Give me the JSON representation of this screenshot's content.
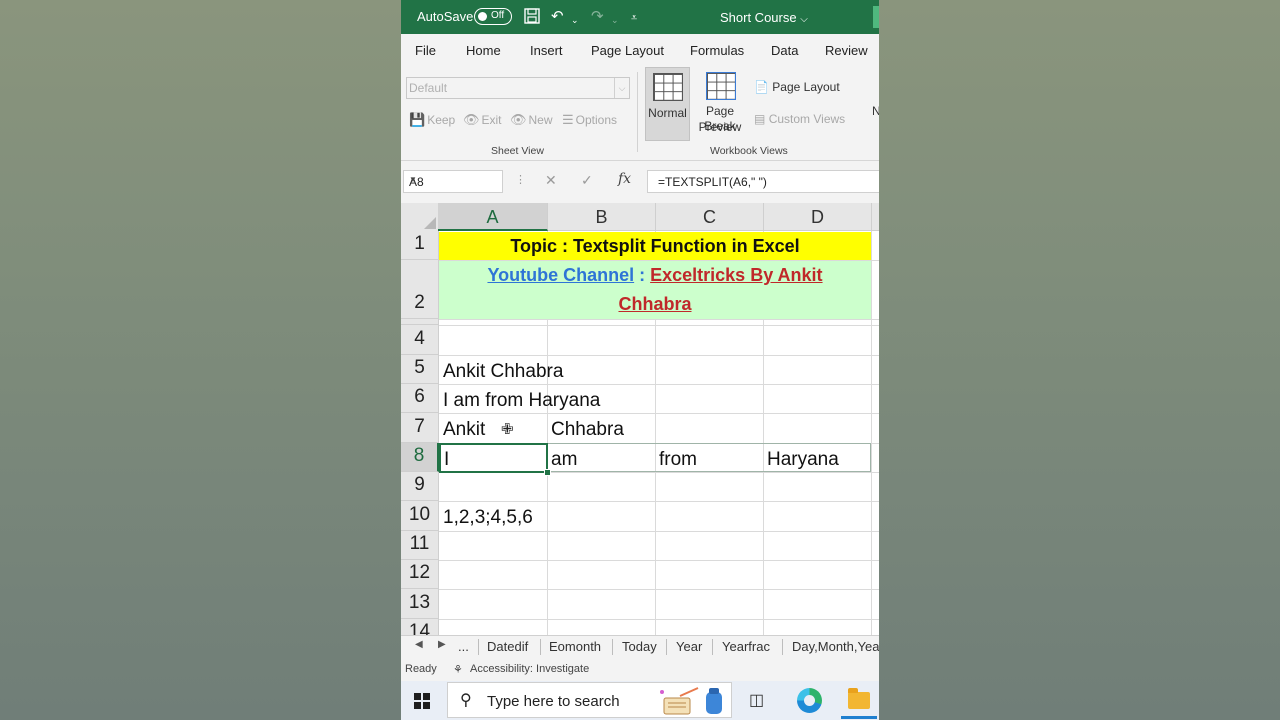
{
  "titlebar": {
    "autosave_label": "AutoSave",
    "autosave_state": "Off",
    "document_title": "Short Course",
    "icons": [
      "save-icon",
      "undo-icon",
      "redo-icon",
      "customize-toolbar-icon"
    ]
  },
  "menu": {
    "tabs": [
      "File",
      "Home",
      "Insert",
      "Page Layout",
      "Formulas",
      "Data",
      "Review"
    ]
  },
  "ribbon": {
    "sheet_view": {
      "dropdown_value": "Default",
      "buttons": [
        "Keep",
        "Exit",
        "New",
        "Options"
      ],
      "group_label": "Sheet View"
    },
    "workbook_views": {
      "normal": "Normal",
      "page_break_line1": "Page Break",
      "page_break_line2": "Preview",
      "page_layout": "Page Layout",
      "custom_views": "Custom Views",
      "group_label": "Workbook Views"
    },
    "cutoff_letter": "N"
  },
  "formula_bar": {
    "name_box": "A8",
    "formula": "=TEXTSPLIT(A6,\" \")"
  },
  "sheet": {
    "columns": [
      "A",
      "B",
      "C",
      "D"
    ],
    "selected_column": "A",
    "rows": [
      "1",
      "2",
      "4",
      "5",
      "6",
      "7",
      "8",
      "9",
      "10",
      "11",
      "12",
      "13",
      "14"
    ],
    "selected_row": "8",
    "banner_title": "Topic : Textsplit Function in Excel",
    "banner_channel_label": "Youtube Channel",
    "banner_colon": " : ",
    "banner_channel_name_line1": "Exceltricks By Ankit",
    "banner_channel_name_line2": "Chhabra",
    "cells": {
      "A5": "Ankit Chhabra",
      "A6": "I am from Haryana",
      "A7": "Ankit",
      "B7": "Chhabra",
      "A8": "I",
      "B8": "am",
      "C8": "from",
      "D8": "Haryana",
      "A10": "1,2,3;4,5,6"
    },
    "banner_colors": {
      "row1": "#ffff00",
      "row2": "#ccffcc",
      "channel_link": "#2e74d6",
      "channel_name": "#c0282a"
    }
  },
  "sheet_tabs": {
    "ellipsis": "...",
    "tabs": [
      "Datedif",
      "Eomonth",
      "Today",
      "Year",
      "Yearfrac",
      "Day,Month,Year"
    ]
  },
  "status": {
    "mode": "Ready",
    "accessibility": "Accessibility: Investigate"
  },
  "taskbar": {
    "search_placeholder": "Type here to search",
    "icons": [
      "windows-start-icon",
      "search-icon",
      "task-view-icon",
      "edge-browser-icon",
      "file-explorer-icon"
    ]
  },
  "accent_color": "#217346"
}
